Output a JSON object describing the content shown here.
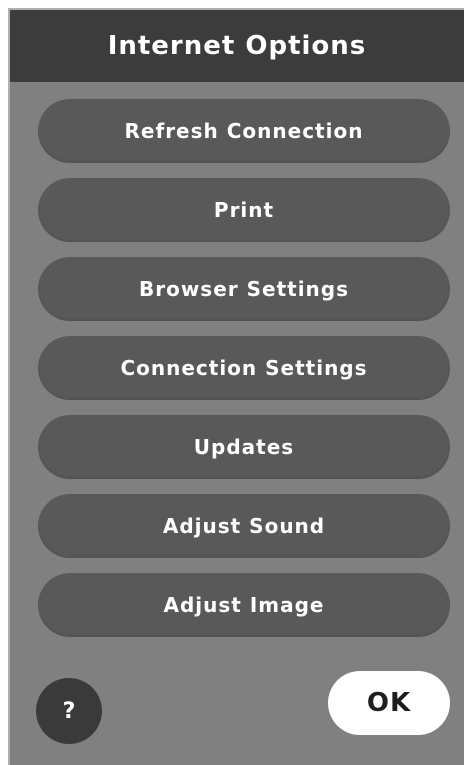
{
  "dialog": {
    "title": "Internet Options"
  },
  "menu": {
    "items": [
      {
        "label": "Refresh Connection"
      },
      {
        "label": "Print"
      },
      {
        "label": "Browser Settings"
      },
      {
        "label": "Connection Settings"
      },
      {
        "label": "Updates"
      },
      {
        "label": "Adjust Sound"
      },
      {
        "label": "Adjust Image"
      }
    ]
  },
  "footer": {
    "help_label": "?",
    "help_icon": "question-mark-icon",
    "ok_label": "OK"
  },
  "colors": {
    "panel_background": "#808080",
    "header_background": "#3c3c3c",
    "button_background": "#595959",
    "help_button_background": "#3a3a3a",
    "ok_button_background": "#ffffff",
    "text_light": "#ffffff",
    "text_dark": "#1e1e1e"
  }
}
